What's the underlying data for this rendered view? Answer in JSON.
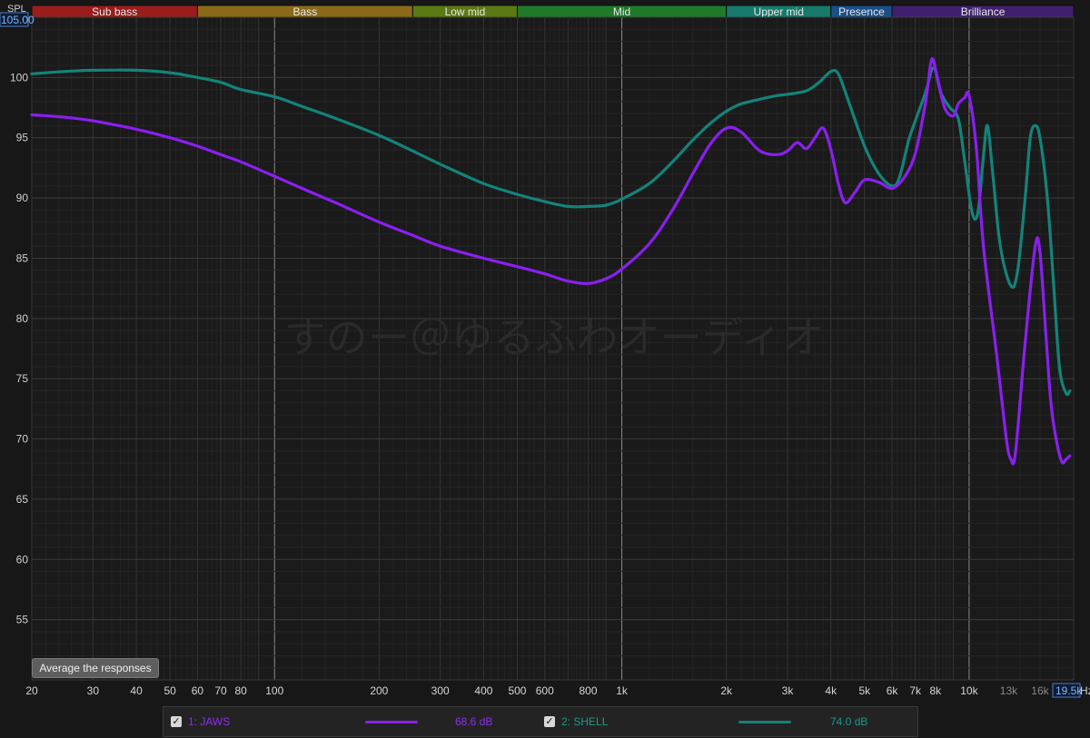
{
  "chart_data": {
    "type": "line",
    "xscale": "log",
    "xlim": [
      20,
      20000
    ],
    "ylim": [
      50,
      105
    ],
    "ylabel": "SPL",
    "y_top_readout": "105.00",
    "x_right_readout": "19.5k",
    "x_unit_label": "Hz",
    "grid": true,
    "watermark": "すのー＠ゆるふわオーディオ",
    "y_ticks": [
      55,
      60,
      65,
      70,
      75,
      80,
      85,
      90,
      95,
      100
    ],
    "x_ticks": [
      {
        "label": "20",
        "value": 20
      },
      {
        "label": "30",
        "value": 30
      },
      {
        "label": "40",
        "value": 40
      },
      {
        "label": "50",
        "value": 50
      },
      {
        "label": "60",
        "value": 60
      },
      {
        "label": "70",
        "value": 70
      },
      {
        "label": "80",
        "value": 80
      },
      {
        "label": "100",
        "value": 100
      },
      {
        "label": "200",
        "value": 200
      },
      {
        "label": "300",
        "value": 300
      },
      {
        "label": "400",
        "value": 400
      },
      {
        "label": "500",
        "value": 500
      },
      {
        "label": "600",
        "value": 600
      },
      {
        "label": "800",
        "value": 800
      },
      {
        "label": "1k",
        "value": 1000
      },
      {
        "label": "2k",
        "value": 2000
      },
      {
        "label": "3k",
        "value": 3000
      },
      {
        "label": "4k",
        "value": 4000
      },
      {
        "label": "5k",
        "value": 5000
      },
      {
        "label": "6k",
        "value": 6000
      },
      {
        "label": "7k",
        "value": 7000
      },
      {
        "label": "8k",
        "value": 8000
      },
      {
        "label": "10k",
        "value": 10000
      },
      {
        "label": "13k",
        "value": 13000
      },
      {
        "label": "16k",
        "value": 16000
      }
    ],
    "bands": [
      {
        "name": "Sub bass",
        "from": 20,
        "to": 60,
        "color": "#9b1c1c"
      },
      {
        "name": "Bass",
        "from": 60,
        "to": 250,
        "color": "#8a6a16"
      },
      {
        "name": "Low mid",
        "from": 250,
        "to": 500,
        "color": "#5c7a14"
      },
      {
        "name": "Mid",
        "from": 500,
        "to": 2000,
        "color": "#1f7a2a"
      },
      {
        "name": "Upper mid",
        "from": 2000,
        "to": 4000,
        "color": "#167a6c"
      },
      {
        "name": "Presence",
        "from": 4000,
        "to": 6000,
        "color": "#1b4f8a"
      },
      {
        "name": "Brilliance",
        "from": 6000,
        "to": 20000,
        "color": "#40206e"
      }
    ],
    "series": [
      {
        "name": "1: JAWS",
        "value_label": "68.6 dB",
        "color": "#8a1ff0",
        "points": [
          [
            20,
            96.9
          ],
          [
            25,
            96.7
          ],
          [
            30,
            96.4
          ],
          [
            40,
            95.7
          ],
          [
            50,
            95.0
          ],
          [
            60,
            94.3
          ],
          [
            70,
            93.6
          ],
          [
            80,
            93.0
          ],
          [
            100,
            91.8
          ],
          [
            120,
            90.8
          ],
          [
            150,
            89.6
          ],
          [
            200,
            88.0
          ],
          [
            250,
            86.9
          ],
          [
            300,
            86.0
          ],
          [
            400,
            85.0
          ],
          [
            500,
            84.3
          ],
          [
            600,
            83.7
          ],
          [
            700,
            83.1
          ],
          [
            800,
            82.9
          ],
          [
            900,
            83.3
          ],
          [
            1000,
            84.1
          ],
          [
            1200,
            86.2
          ],
          [
            1400,
            89.0
          ],
          [
            1600,
            92.0
          ],
          [
            1800,
            94.5
          ],
          [
            2000,
            95.8
          ],
          [
            2200,
            95.5
          ],
          [
            2500,
            93.9
          ],
          [
            2800,
            93.6
          ],
          [
            3000,
            93.9
          ],
          [
            3200,
            94.6
          ],
          [
            3400,
            94.1
          ],
          [
            3600,
            95.0
          ],
          [
            3800,
            95.8
          ],
          [
            4000,
            94.0
          ],
          [
            4200,
            91.2
          ],
          [
            4400,
            89.6
          ],
          [
            4700,
            90.5
          ],
          [
            5000,
            91.5
          ],
          [
            5500,
            91.3
          ],
          [
            6000,
            90.8
          ],
          [
            6500,
            91.7
          ],
          [
            7000,
            93.7
          ],
          [
            7500,
            98.0
          ],
          [
            7800,
            101.5
          ],
          [
            8100,
            100.0
          ],
          [
            8500,
            97.5
          ],
          [
            9000,
            96.8
          ],
          [
            9300,
            97.8
          ],
          [
            9700,
            98.3
          ],
          [
            10000,
            98.5
          ],
          [
            10500,
            94.0
          ],
          [
            11000,
            86.0
          ],
          [
            12000,
            77.0
          ],
          [
            12800,
            70.0
          ],
          [
            13200,
            68.3
          ],
          [
            13600,
            68.9
          ],
          [
            14500,
            78.0
          ],
          [
            15500,
            86.0
          ],
          [
            16000,
            85.5
          ],
          [
            16600,
            79.0
          ],
          [
            17200,
            73.0
          ],
          [
            17800,
            70.0
          ],
          [
            18500,
            68.1
          ],
          [
            19000,
            68.3
          ],
          [
            19500,
            68.6
          ]
        ]
      },
      {
        "name": "2: SHELL",
        "value_label": "74.0 dB",
        "color": "#13837a",
        "points": [
          [
            20,
            100.3
          ],
          [
            25,
            100.5
          ],
          [
            30,
            100.6
          ],
          [
            40,
            100.6
          ],
          [
            50,
            100.4
          ],
          [
            60,
            100.0
          ],
          [
            70,
            99.6
          ],
          [
            80,
            99.0
          ],
          [
            100,
            98.4
          ],
          [
            120,
            97.6
          ],
          [
            150,
            96.6
          ],
          [
            200,
            95.2
          ],
          [
            250,
            93.9
          ],
          [
            300,
            92.8
          ],
          [
            400,
            91.2
          ],
          [
            500,
            90.3
          ],
          [
            600,
            89.7
          ],
          [
            700,
            89.3
          ],
          [
            800,
            89.3
          ],
          [
            900,
            89.4
          ],
          [
            1000,
            89.9
          ],
          [
            1200,
            91.2
          ],
          [
            1400,
            93.0
          ],
          [
            1600,
            94.8
          ],
          [
            1800,
            96.2
          ],
          [
            2000,
            97.2
          ],
          [
            2200,
            97.8
          ],
          [
            2500,
            98.2
          ],
          [
            2800,
            98.5
          ],
          [
            3000,
            98.6
          ],
          [
            3400,
            98.9
          ],
          [
            3700,
            99.6
          ],
          [
            4000,
            100.5
          ],
          [
            4200,
            100.3
          ],
          [
            4500,
            98.0
          ],
          [
            5000,
            94.3
          ],
          [
            5500,
            92.0
          ],
          [
            6000,
            91.0
          ],
          [
            6300,
            91.7
          ],
          [
            6700,
            94.8
          ],
          [
            7000,
            96.4
          ],
          [
            7500,
            98.8
          ],
          [
            7900,
            100.8
          ],
          [
            8300,
            98.7
          ],
          [
            8800,
            97.5
          ],
          [
            9300,
            96.6
          ],
          [
            9700,
            93.2
          ],
          [
            10200,
            88.8
          ],
          [
            10600,
            88.8
          ],
          [
            11000,
            93.5
          ],
          [
            11300,
            96.0
          ],
          [
            11700,
            92.0
          ],
          [
            12300,
            86.0
          ],
          [
            13200,
            82.7
          ],
          [
            13800,
            84.0
          ],
          [
            14500,
            90.0
          ],
          [
            15000,
            95.0
          ],
          [
            15500,
            96.0
          ],
          [
            16000,
            95.0
          ],
          [
            16800,
            90.0
          ],
          [
            17500,
            83.0
          ],
          [
            18200,
            76.0
          ],
          [
            19000,
            73.8
          ],
          [
            19500,
            74.0
          ]
        ]
      }
    ]
  },
  "ui": {
    "avg_button_label": "Average the responses",
    "check_mark": "✓"
  }
}
